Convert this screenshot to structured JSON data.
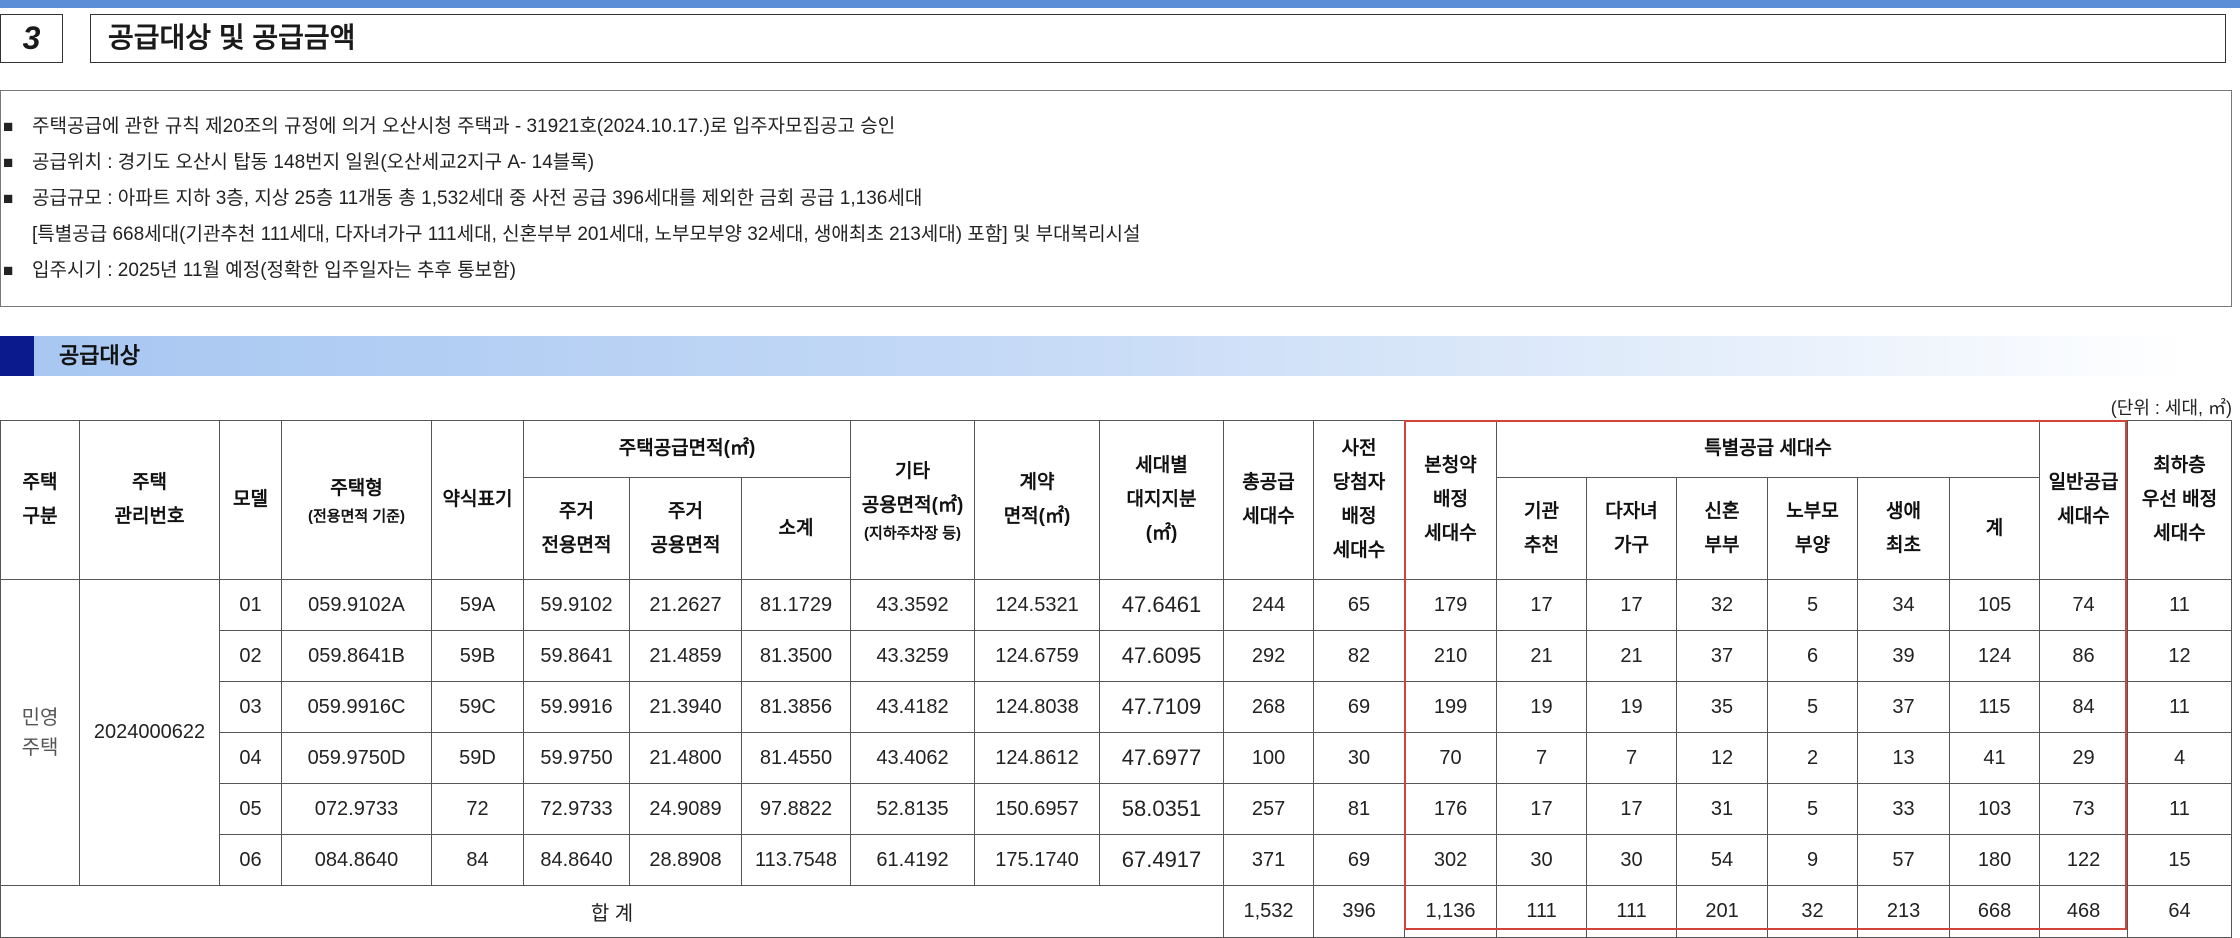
{
  "section": {
    "number": "3",
    "title": "공급대상 및 공급금액"
  },
  "info": {
    "lines": [
      {
        "bullet": "■",
        "text": "주택공급에 관한 규칙 제20조의 규정에 의거 오산시청 주택과 - 31921호(2024.10.17.)로 입주자모집공고 승인"
      },
      {
        "bullet": "■",
        "text": "공급위치 : 경기도 오산시 탑동 148번지 일원(오산세교2지구 A- 14블록)"
      },
      {
        "bullet": "■",
        "text": "공급규모 : 아파트 지하 3층, 지상 25층 11개동 총 1,532세대 중 사전 공급 396세대를 제외한 금회 공급 1,136세대"
      },
      {
        "bullet": "",
        "text": "[특별공급 668세대(기관추천 111세대, 다자녀가구 111세대, 신혼부부 201세대, 노부모부양 32세대, 생애최초 213세대) 포함] 및 부대복리시설"
      },
      {
        "bullet": "■",
        "text": "입주시기 : 2025년 11월 예정(정확한 입주일자는 추후 통보함)"
      }
    ]
  },
  "subsection": {
    "title": "공급대상"
  },
  "unit_note": "(단위 : 세대, ㎡)",
  "table": {
    "headers": {
      "category": "주택\n구분",
      "management_no": "주택\n관리번호",
      "model": "모델",
      "housing_type": {
        "main": "주택형",
        "sub": "(전용면적 기준)"
      },
      "short": "약식표기",
      "supply_area": "주택공급면적(㎡)",
      "exclusive": "주거\n전용면적",
      "common": "주거\n공용면적",
      "subtotal": "소계",
      "other_common": {
        "main": "기타\n공용면적(㎡)",
        "sub": "(지하주차장 등)"
      },
      "contract": "계약\n면적(㎡)",
      "land_share": "세대별\n대지지분\n(㎡)",
      "total_supply": "총공급\n세대수",
      "pre_winners": "사전\n당첨자\n배정\n세대수",
      "main_subscription": "본청약\n배정\n세대수",
      "special": "특별공급 세대수",
      "institution": "기관\n추천",
      "multi_child": "다자녀\n가구",
      "newlywed": "신혼\n부부",
      "elderly_parents": "노부모\n부양",
      "first_time": "생애\n최초",
      "special_total": "계",
      "general": "일반공급\n세대수",
      "lowest_floor": "최하층\n우선 배정\n세대수"
    },
    "group": {
      "category": "민영\n주택",
      "management_no": "2024000622"
    },
    "rows": [
      {
        "model": "01",
        "housing_type": "059.9102A",
        "short": "59A",
        "exclusive": "59.9102",
        "common": "21.2627",
        "subtotal": "81.1729",
        "other_common": "43.3592",
        "contract": "124.5321",
        "land_share": "47.6461",
        "total_supply": "244",
        "pre_winners": "65",
        "main_subscription": "179",
        "institution": "17",
        "multi_child": "17",
        "newlywed": "32",
        "elderly_parents": "5",
        "first_time": "34",
        "special_total": "105",
        "general": "74",
        "lowest_floor": "11"
      },
      {
        "model": "02",
        "housing_type": "059.8641B",
        "short": "59B",
        "exclusive": "59.8641",
        "common": "21.4859",
        "subtotal": "81.3500",
        "other_common": "43.3259",
        "contract": "124.6759",
        "land_share": "47.6095",
        "total_supply": "292",
        "pre_winners": "82",
        "main_subscription": "210",
        "institution": "21",
        "multi_child": "21",
        "newlywed": "37",
        "elderly_parents": "6",
        "first_time": "39",
        "special_total": "124",
        "general": "86",
        "lowest_floor": "12"
      },
      {
        "model": "03",
        "housing_type": "059.9916C",
        "short": "59C",
        "exclusive": "59.9916",
        "common": "21.3940",
        "subtotal": "81.3856",
        "other_common": "43.4182",
        "contract": "124.8038",
        "land_share": "47.7109",
        "total_supply": "268",
        "pre_winners": "69",
        "main_subscription": "199",
        "institution": "19",
        "multi_child": "19",
        "newlywed": "35",
        "elderly_parents": "5",
        "first_time": "37",
        "special_total": "115",
        "general": "84",
        "lowest_floor": "11"
      },
      {
        "model": "04",
        "housing_type": "059.9750D",
        "short": "59D",
        "exclusive": "59.9750",
        "common": "21.4800",
        "subtotal": "81.4550",
        "other_common": "43.4062",
        "contract": "124.8612",
        "land_share": "47.6977",
        "total_supply": "100",
        "pre_winners": "30",
        "main_subscription": "70",
        "institution": "7",
        "multi_child": "7",
        "newlywed": "12",
        "elderly_parents": "2",
        "first_time": "13",
        "special_total": "41",
        "general": "29",
        "lowest_floor": "4"
      },
      {
        "model": "05",
        "housing_type": "072.9733",
        "short": "72",
        "exclusive": "72.9733",
        "common": "24.9089",
        "subtotal": "97.8822",
        "other_common": "52.8135",
        "contract": "150.6957",
        "land_share": "58.0351",
        "total_supply": "257",
        "pre_winners": "81",
        "main_subscription": "176",
        "institution": "17",
        "multi_child": "17",
        "newlywed": "31",
        "elderly_parents": "5",
        "first_time": "33",
        "special_total": "103",
        "general": "73",
        "lowest_floor": "11"
      },
      {
        "model": "06",
        "housing_type": "084.8640",
        "short": "84",
        "exclusive": "84.8640",
        "common": "28.8908",
        "subtotal": "113.7548",
        "other_common": "61.4192",
        "contract": "175.1740",
        "land_share": "67.4917",
        "total_supply": "371",
        "pre_winners": "69",
        "main_subscription": "302",
        "institution": "30",
        "multi_child": "30",
        "newlywed": "54",
        "elderly_parents": "9",
        "first_time": "57",
        "special_total": "180",
        "general": "122",
        "lowest_floor": "15"
      }
    ],
    "total": {
      "label": "합 계",
      "total_supply": "1,532",
      "pre_winners": "396",
      "main_subscription": "1,136",
      "institution": "111",
      "multi_child": "111",
      "newlywed": "201",
      "elderly_parents": "32",
      "first_time": "213",
      "special_total": "668",
      "general": "468",
      "lowest_floor": "64"
    }
  },
  "colors": {
    "top_bar": "#5b8ed6",
    "subhead_mark": "#0b1a8c",
    "highlight_border": "#d2443a"
  }
}
